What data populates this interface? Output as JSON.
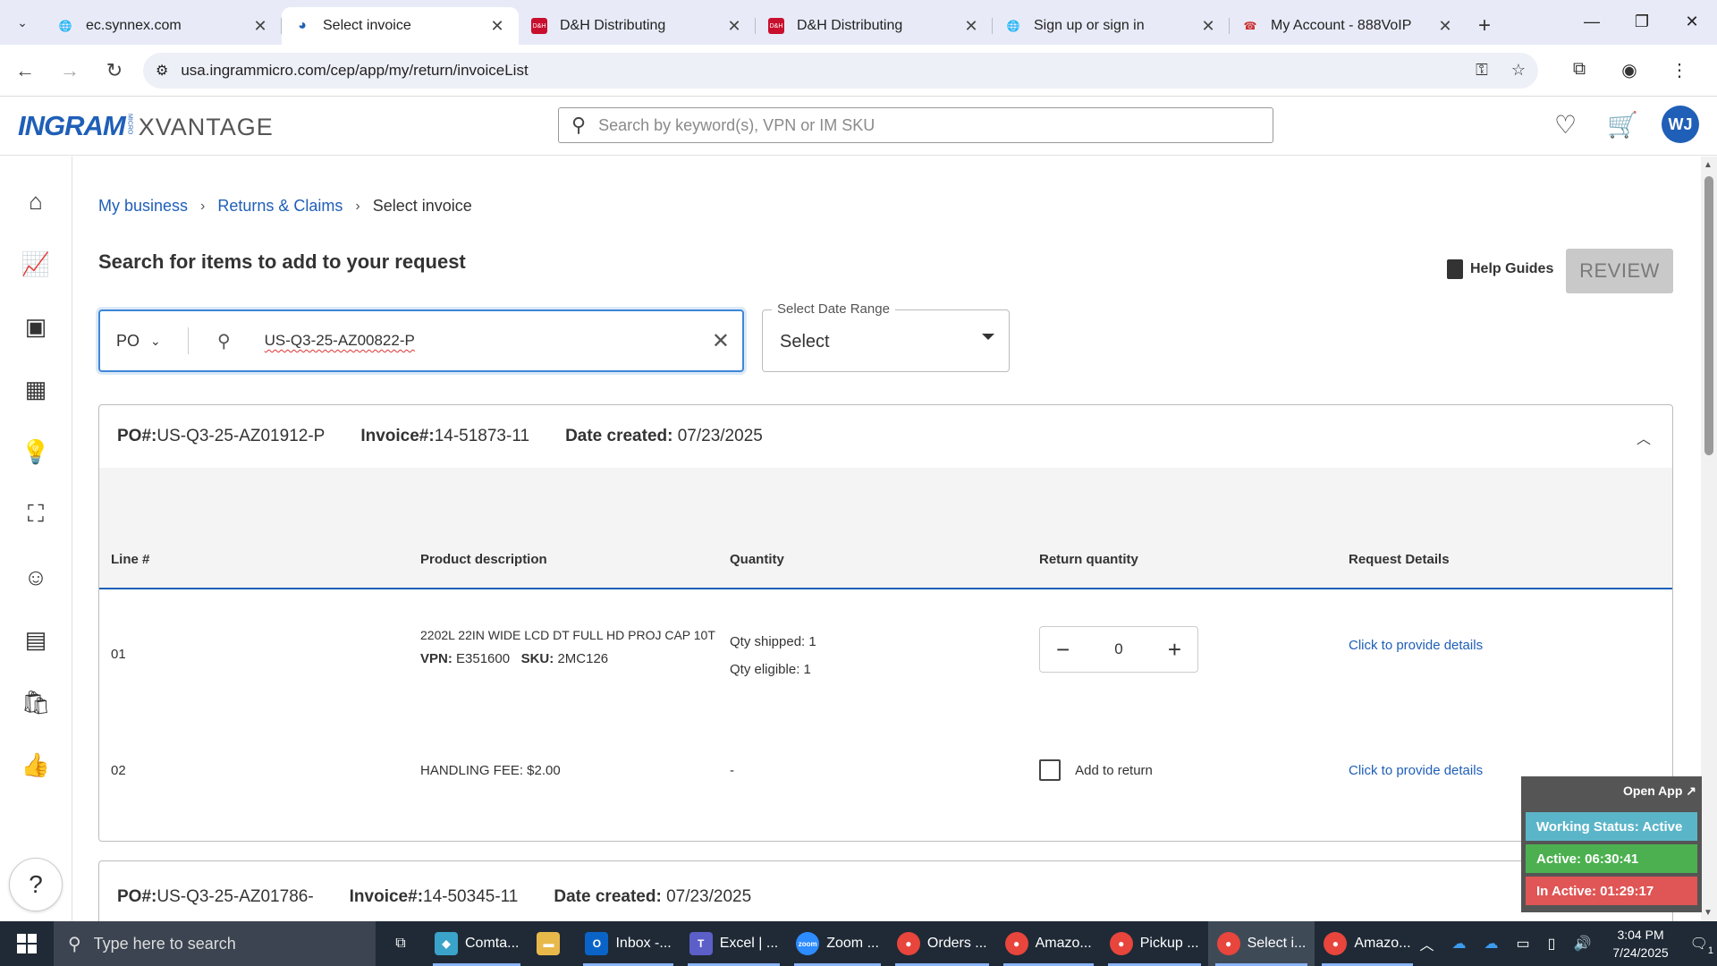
{
  "browser": {
    "tabs": [
      {
        "title": "ec.synnex.com",
        "active": false
      },
      {
        "title": "Select invoice",
        "active": true
      },
      {
        "title": "D&H Distributing",
        "active": false
      },
      {
        "title": "D&H Distributing",
        "active": false
      },
      {
        "title": "Sign up or sign in",
        "active": false
      },
      {
        "title": "My Account - 888VoIP",
        "active": false
      }
    ],
    "url": "usa.ingrammicro.com/cep/app/my/return/invoiceList"
  },
  "header": {
    "logo_main": "INGRAM",
    "logo_micro": "MICRO",
    "logo_sub": "XVANTAGE",
    "search_placeholder": "Search by keyword(s), VPN or IM SKU",
    "avatar_initials": "WJ"
  },
  "breadcrumb": {
    "items": [
      "My business",
      "Returns & Claims"
    ],
    "current": "Select invoice"
  },
  "main": {
    "title": "Search for items to add to your request",
    "help_guides": "Help Guides",
    "review_label": "REVIEW",
    "search_type": "PO",
    "search_value": "US-Q3-25-AZ00822-P",
    "date_range_label": "Select Date Range",
    "date_range_value": "Select"
  },
  "invoice1": {
    "po_label": "PO#:",
    "po": "US-Q3-25-AZ01912-P",
    "inv_label": "Invoice#:",
    "invoice": "14-51873-11",
    "date_label": "Date created:",
    "date": "07/23/2025",
    "columns": [
      "Line #",
      "Product description",
      "Quantity",
      "Return quantity",
      "Request Details"
    ],
    "rows": [
      {
        "line": "01",
        "desc": "2202L 22IN WIDE LCD DT FULL HD PROJ CAP 10T",
        "vpn_label": "VPN:",
        "vpn": "E351600",
        "sku_label": "SKU:",
        "sku": "2MC126",
        "qty_shipped": "Qty shipped: 1",
        "qty_eligible": "Qty eligible: 1",
        "return_qty": "0",
        "details": "Click to provide details"
      },
      {
        "line": "02",
        "desc": "HANDLING FEE: $2.00",
        "qty": "-",
        "add_label": "Add to return",
        "details": "Click to provide details"
      }
    ]
  },
  "invoice2": {
    "po_label": "PO#:",
    "po": "US-Q3-25-AZ01786-",
    "inv_label": "Invoice#:",
    "invoice": "14-50345-11",
    "date_label": "Date created:",
    "date": "07/23/2025"
  },
  "widget": {
    "open_app": "Open App ↗",
    "working": "Working Status: Active",
    "active": "Active: 06:30:41",
    "inactive": "In Active: 01:29:17",
    "colors": {
      "working": "#5bb5c8",
      "active": "#4cb050",
      "inactive": "#e05555"
    }
  },
  "taskbar": {
    "search_placeholder": "Type here to search",
    "items": [
      {
        "label": "Comta...",
        "icon": "comtrade-icon"
      },
      {
        "label": "",
        "icon": "file-explorer-icon"
      },
      {
        "label": "Inbox -...",
        "icon": "outlook-icon"
      },
      {
        "label": "Excel | ...",
        "icon": "teams-icon"
      },
      {
        "label": "Zoom ...",
        "icon": "zoom-icon"
      },
      {
        "label": "Orders ...",
        "icon": "chrome-icon"
      },
      {
        "label": "Amazo...",
        "icon": "chrome-icon"
      },
      {
        "label": "Pickup ...",
        "icon": "chrome-icon"
      },
      {
        "label": "Select i...",
        "icon": "chrome-icon"
      },
      {
        "label": "Amazo...",
        "icon": "chrome-icon"
      }
    ],
    "time": "3:04 PM",
    "date": "7/24/2025",
    "notif_count": "1"
  }
}
